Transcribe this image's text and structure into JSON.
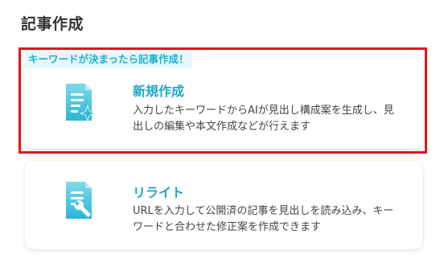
{
  "section": {
    "title": "記事作成"
  },
  "new_article": {
    "callout": "キーワードが決まったら記事作成！",
    "title": "新規作成",
    "description": "入力したキーワードからAIが見出し構成案を生成し、見出しの編集や本文作成などが行えます",
    "icon": "document-sparkle-icon"
  },
  "rewrite": {
    "title": "リライト",
    "description": "URLを入力して公開済の記事を見出しを読み込み、キーワードと合わせた修正案を作成できます",
    "icon": "document-wrench-icon"
  },
  "colors": {
    "accent": "#1aa6c6",
    "highlight_border": "#e3141b",
    "callout_bg": "#e6f8fb"
  }
}
